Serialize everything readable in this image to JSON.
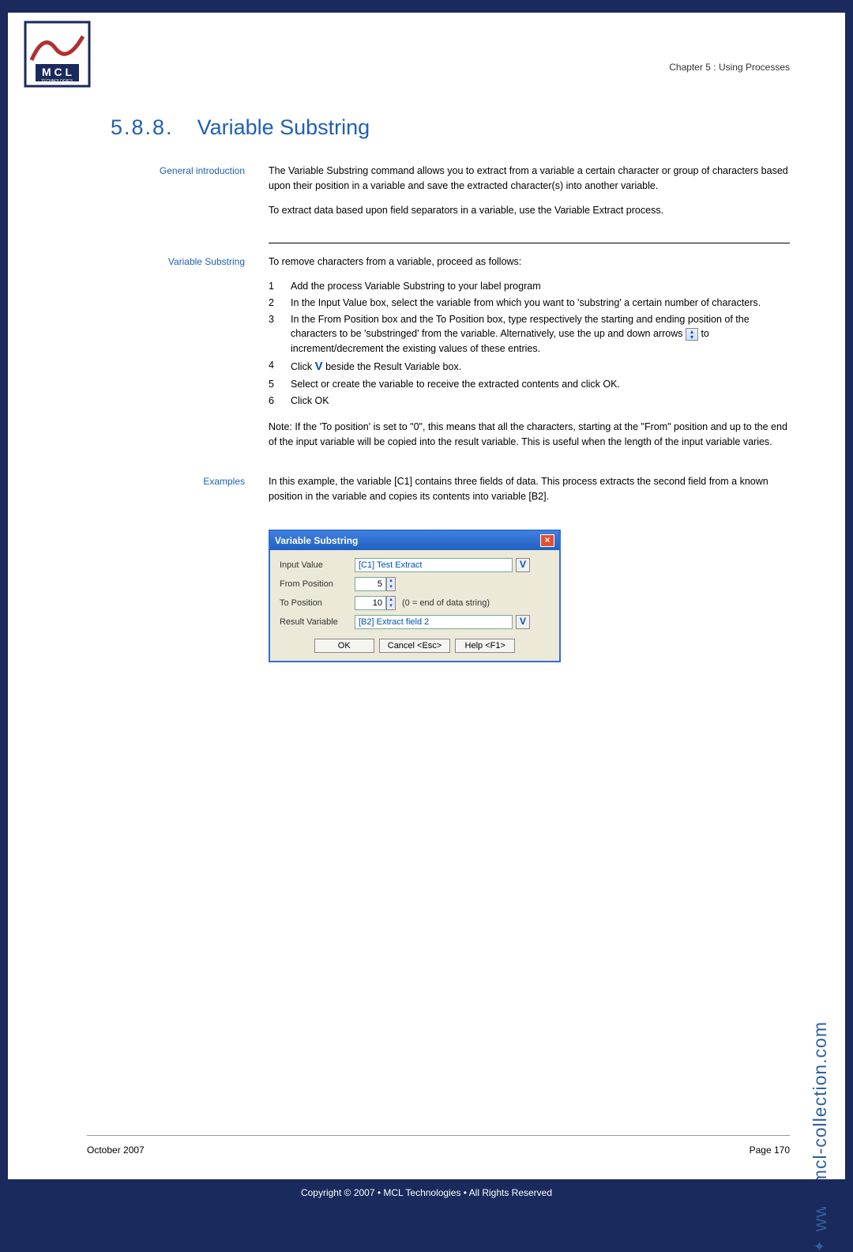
{
  "chapter": "Chapter 5 : Using Processes",
  "heading_num": "5.8.8.",
  "heading_title": "Variable Substring",
  "sections": {
    "intro": {
      "label": "General introduction",
      "p1": "The Variable Substring command allows you to extract from a variable a certain character or group of characters based upon their position in a variable and save the extracted character(s) into another variable.",
      "p2": "To extract data based upon field separators in a variable, use the Variable Extract process."
    },
    "steps": {
      "label": "Variable Substring",
      "intro": "To remove characters from a variable, proceed as follows:",
      "items": [
        "Add the process Variable Substring to your label program",
        "In the Input Value box, select the variable from which you want to 'substring' a certain number of characters.",
        "In the From Position box and the To Position box, type respectively the starting and ending position of the characters to be 'substringed' from the variable. Alternatively, use the up and down arrows",
        "to increment/decrement the existing values of these entries.",
        "Click",
        "beside the Result Variable box.",
        "Select or create the variable to receive the extracted contents and click OK.",
        "Click OK"
      ],
      "note": "Note: If the 'To position' is set to \"0\", this means that all the characters, starting at the \"From\" position and up to the end of the input variable will be copied into the result variable. This is useful when the length of the input variable varies."
    },
    "examples": {
      "label": "Examples",
      "p1": "In this example, the variable [C1] contains three fields of data. This process extracts the second field from a known position in the variable and copies its contents into variable [B2]."
    }
  },
  "dialog": {
    "title": "Variable Substring",
    "rows": {
      "input_value_label": "Input Value",
      "input_value": "[C1] Test Extract",
      "from_label": "From Position",
      "from_value": "5",
      "to_label": "To Position",
      "to_value": "10",
      "to_hint": "(0 = end of data string)",
      "result_label": "Result Variable",
      "result_value": "[B2] Extract field 2"
    },
    "buttons": {
      "ok": "OK",
      "cancel": "Cancel <Esc>",
      "help": "Help <F1>"
    }
  },
  "side_url": "www.mcl-collection.com",
  "footer": {
    "date": "October 2007",
    "page": "Page 170"
  },
  "copyright": "Copyright © 2007 • MCL Technologies • All Rights Reserved"
}
